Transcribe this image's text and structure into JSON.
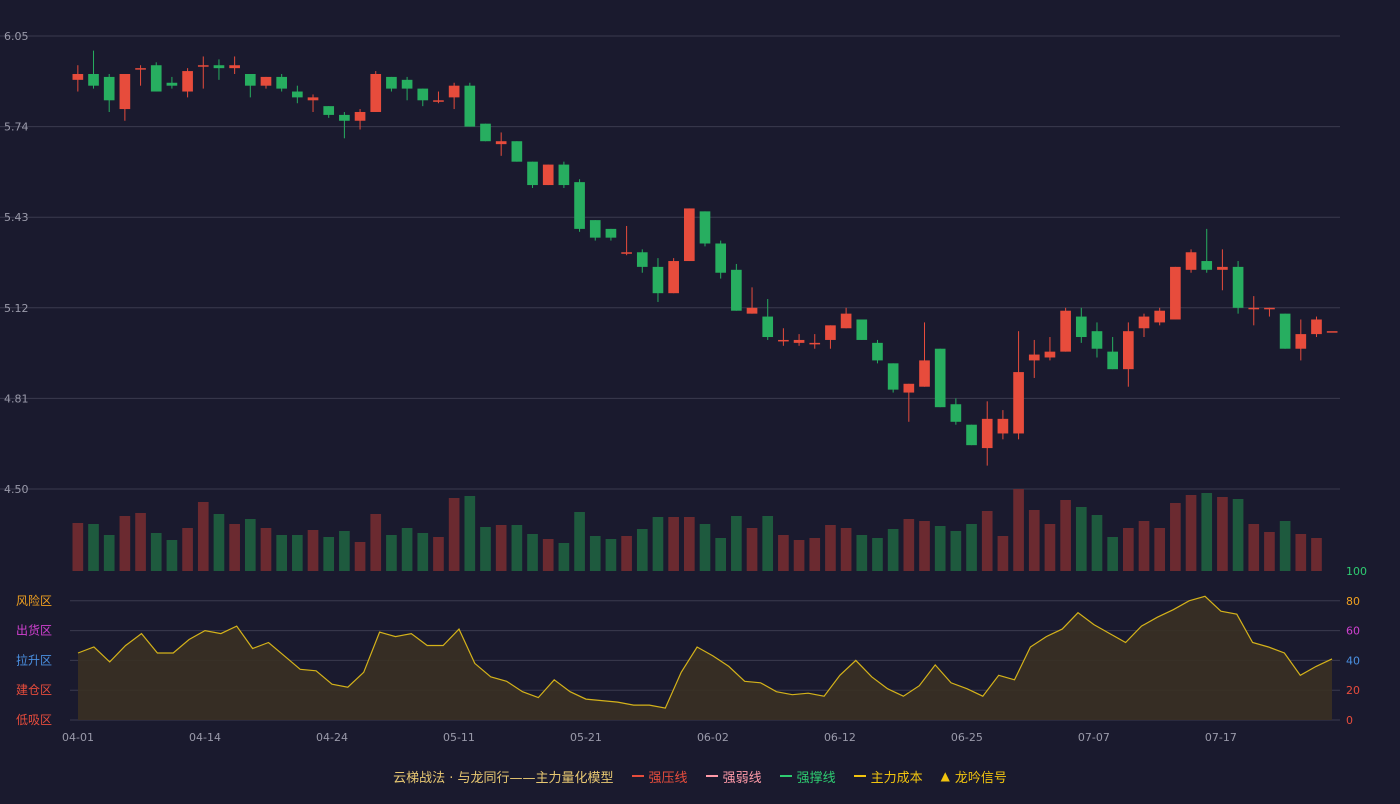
{
  "chart_data": {
    "type": "candlestick",
    "dates": [
      "04-01",
      "04-02",
      "04-03",
      "04-07",
      "04-08",
      "04-09",
      "04-10",
      "04-11",
      "04-14",
      "04-15",
      "04-16",
      "04-17",
      "04-18",
      "04-21",
      "04-22",
      "04-23",
      "04-24",
      "04-25",
      "04-28",
      "04-29",
      "04-30",
      "05-06",
      "05-07",
      "05-08",
      "05-09",
      "05-11",
      "05-12",
      "05-13",
      "05-14",
      "05-15",
      "05-16",
      "05-19",
      "05-20",
      "05-21",
      "05-22",
      "05-23",
      "05-26",
      "05-27",
      "05-28",
      "05-29",
      "05-30",
      "06-02",
      "06-03",
      "06-04",
      "06-05",
      "06-06",
      "06-09",
      "06-10",
      "06-11",
      "06-12",
      "06-13",
      "06-16",
      "06-17",
      "06-18",
      "06-19",
      "06-20",
      "06-23",
      "06-24",
      "06-25",
      "06-26",
      "06-27",
      "06-30",
      "07-01",
      "07-02",
      "07-03",
      "07-04",
      "07-07",
      "07-08",
      "07-09",
      "07-10",
      "07-11",
      "07-14",
      "07-15",
      "07-16",
      "07-17",
      "07-18",
      "07-21",
      "07-22",
      "07-23",
      "07-24",
      "07-25"
    ],
    "ohlc": [
      [
        5.9,
        5.92,
        5.86,
        5.95
      ],
      [
        5.92,
        5.88,
        5.87,
        6.0
      ],
      [
        5.91,
        5.83,
        5.79,
        5.92
      ],
      [
        5.8,
        5.92,
        5.76,
        5.92
      ],
      [
        5.94,
        5.94,
        5.88,
        5.95
      ],
      [
        5.95,
        5.86,
        5.86,
        5.96
      ],
      [
        5.89,
        5.88,
        5.87,
        5.91
      ],
      [
        5.86,
        5.93,
        5.84,
        5.94
      ],
      [
        5.95,
        5.95,
        5.87,
        5.98
      ],
      [
        5.95,
        5.94,
        5.9,
        5.97
      ],
      [
        5.94,
        5.95,
        5.92,
        5.98
      ],
      [
        5.92,
        5.88,
        5.84,
        5.92
      ],
      [
        5.88,
        5.91,
        5.87,
        5.91
      ],
      [
        5.91,
        5.87,
        5.86,
        5.92
      ],
      [
        5.86,
        5.84,
        5.82,
        5.88
      ],
      [
        5.83,
        5.84,
        5.79,
        5.85
      ],
      [
        5.81,
        5.78,
        5.77,
        5.81
      ],
      [
        5.78,
        5.76,
        5.7,
        5.79
      ],
      [
        5.76,
        5.79,
        5.73,
        5.8
      ],
      [
        5.79,
        5.92,
        5.79,
        5.93
      ],
      [
        5.91,
        5.87,
        5.86,
        5.91
      ],
      [
        5.9,
        5.87,
        5.83,
        5.91
      ],
      [
        5.87,
        5.83,
        5.81,
        5.87
      ],
      [
        5.83,
        5.83,
        5.82,
        5.86
      ],
      [
        5.84,
        5.88,
        5.8,
        5.89
      ],
      [
        5.88,
        5.74,
        5.74,
        5.89
      ],
      [
        5.75,
        5.69,
        5.69,
        5.75
      ],
      [
        5.68,
        5.69,
        5.64,
        5.72
      ],
      [
        5.69,
        5.62,
        5.62,
        5.69
      ],
      [
        5.62,
        5.54,
        5.53,
        5.62
      ],
      [
        5.54,
        5.61,
        5.54,
        5.61
      ],
      [
        5.61,
        5.54,
        5.53,
        5.62
      ],
      [
        5.55,
        5.39,
        5.38,
        5.56
      ],
      [
        5.42,
        5.36,
        5.35,
        5.42
      ],
      [
        5.39,
        5.36,
        5.35,
        5.39
      ],
      [
        5.31,
        5.31,
        5.3,
        5.4
      ],
      [
        5.31,
        5.26,
        5.24,
        5.32
      ],
      [
        5.26,
        5.17,
        5.14,
        5.29
      ],
      [
        5.17,
        5.28,
        5.17,
        5.29
      ],
      [
        5.28,
        5.46,
        5.28,
        5.46
      ],
      [
        5.45,
        5.34,
        5.33,
        5.45
      ],
      [
        5.34,
        5.24,
        5.22,
        5.35
      ],
      [
        5.25,
        5.11,
        5.11,
        5.27
      ],
      [
        5.1,
        5.12,
        5.1,
        5.19
      ],
      [
        5.09,
        5.02,
        5.01,
        5.15
      ],
      [
        5.01,
        5.01,
        4.99,
        5.05
      ],
      [
        5.0,
        5.01,
        4.99,
        5.03
      ],
      [
        5.0,
        5.0,
        4.98,
        5.03
      ],
      [
        5.01,
        5.06,
        4.98,
        5.06
      ],
      [
        5.05,
        5.1,
        5.05,
        5.12
      ],
      [
        5.08,
        5.01,
        5.01,
        5.08
      ],
      [
        5.0,
        4.94,
        4.93,
        5.01
      ],
      [
        4.93,
        4.84,
        4.83,
        4.93
      ],
      [
        4.83,
        4.86,
        4.73,
        4.86
      ],
      [
        4.85,
        4.94,
        4.85,
        5.07
      ],
      [
        4.98,
        4.78,
        4.78,
        4.98
      ],
      [
        4.79,
        4.73,
        4.72,
        4.81
      ],
      [
        4.72,
        4.65,
        4.65,
        4.72
      ],
      [
        4.64,
        4.74,
        4.58,
        4.8
      ],
      [
        4.69,
        4.74,
        4.67,
        4.77
      ],
      [
        4.69,
        4.9,
        4.67,
        5.04
      ],
      [
        4.94,
        4.96,
        4.88,
        5.01
      ],
      [
        4.95,
        4.97,
        4.94,
        5.02
      ],
      [
        4.97,
        5.11,
        4.97,
        5.12
      ],
      [
        5.09,
        5.02,
        5.0,
        5.12
      ],
      [
        5.04,
        4.98,
        4.95,
        5.07
      ],
      [
        4.97,
        4.91,
        4.91,
        5.02
      ],
      [
        4.91,
        5.04,
        4.85,
        5.07
      ],
      [
        5.05,
        5.09,
        5.02,
        5.1
      ],
      [
        5.07,
        5.11,
        5.06,
        5.12
      ],
      [
        5.08,
        5.26,
        5.08,
        5.26
      ],
      [
        5.25,
        5.31,
        5.24,
        5.32
      ],
      [
        5.28,
        5.25,
        5.24,
        5.39
      ],
      [
        5.25,
        5.26,
        5.18,
        5.32
      ],
      [
        5.26,
        5.12,
        5.1,
        5.28
      ],
      [
        5.12,
        5.12,
        5.06,
        5.16
      ],
      [
        5.12,
        5.12,
        5.09,
        5.12
      ],
      [
        5.1,
        4.98,
        4.98,
        5.1
      ],
      [
        4.98,
        5.03,
        4.94,
        5.08
      ],
      [
        5.03,
        5.08,
        5.02,
        5.09
      ],
      [
        5.04,
        5.04,
        5.04,
        5.04
      ]
    ],
    "volume_note": "relative volume bars colored by candle direction",
    "volume": [
      48,
      47,
      36,
      55,
      58,
      38,
      31,
      43,
      69,
      57,
      47,
      52,
      43,
      36,
      36,
      41,
      34,
      40,
      29,
      57,
      36,
      43,
      38,
      34,
      73,
      75,
      44,
      46,
      46,
      37,
      32,
      28,
      59,
      35,
      32,
      35,
      42,
      54,
      54,
      54,
      47,
      33,
      55,
      43,
      55,
      36,
      31,
      33,
      46,
      43,
      36,
      33,
      42,
      52,
      50,
      45,
      40,
      47,
      60,
      35,
      82,
      61,
      47,
      71,
      64,
      56,
      34,
      43,
      50,
      43,
      68,
      76,
      78,
      74,
      72,
      47,
      39,
      50,
      37,
      33
    ],
    "oscillator": [
      45,
      49,
      39,
      50,
      58,
      45,
      45,
      54,
      60,
      58,
      63,
      48,
      52,
      43,
      34,
      33,
      24,
      22,
      32,
      59,
      56,
      58,
      50,
      50,
      61,
      38,
      29,
      26,
      19,
      15,
      27,
      19,
      14,
      13,
      12,
      10,
      10,
      8,
      32,
      49,
      43,
      36,
      26,
      25,
      19,
      17,
      18,
      16,
      30,
      40,
      29,
      21,
      16,
      23,
      37,
      25,
      21,
      16,
      30,
      27,
      49,
      56,
      61,
      72,
      64,
      58,
      52,
      63,
      69,
      74,
      80,
      83,
      73,
      71,
      52,
      49,
      45,
      30,
      36,
      41
    ],
    "price_ticks": [
      "6.05",
      "5.74",
      "5.43",
      "5.12",
      "4.81",
      "4.50"
    ],
    "price_range": [
      4.5,
      6.05
    ],
    "osc_ticks": [
      "100",
      "80",
      "60",
      "40",
      "20",
      "0"
    ],
    "osc_range": [
      0,
      100
    ],
    "zones": [
      "风险区",
      "出货区",
      "拉升区",
      "建仓区",
      "低吸区"
    ],
    "x_ticks": [
      {
        "index": 0,
        "label": "04-01"
      },
      {
        "index": 8,
        "label": "04-14"
      },
      {
        "index": 16,
        "label": "04-24"
      },
      {
        "index": 24,
        "label": "05-11"
      },
      {
        "index": 32,
        "label": "05-21"
      },
      {
        "index": 40,
        "label": "06-02"
      },
      {
        "index": 48,
        "label": "06-12"
      },
      {
        "index": 56,
        "label": "06-25"
      },
      {
        "index": 64,
        "label": "07-07"
      },
      {
        "index": 72,
        "label": "07-17"
      }
    ],
    "colors": {
      "background": "#1a1a2e",
      "up": "#e74c3c",
      "down": "#27ae60",
      "grid": "#3a3a4e",
      "axis_text": "#9a9aaa",
      "osc_line": "#d4b21a",
      "osc_fill": "#3a3024",
      "zone_colors": [
        "#f0a020",
        "#d040d0",
        "#4a90e2",
        "#e74c3c",
        "#e74c3c"
      ],
      "osc_tick_colors": [
        "#2ecc71",
        "#f0a020",
        "#d040d0",
        "#4a90e2",
        "#e74c3c",
        "#e74c3c"
      ]
    },
    "grid": true
  },
  "legend": {
    "title": "云梯战法 · 与龙同行——主力量化模型",
    "items": [
      {
        "label": "强压线",
        "color": "#e74c3c",
        "style": "solid"
      },
      {
        "label": "强弱线",
        "color": "#ff9aa8",
        "style": "dashed"
      },
      {
        "label": "强撑线",
        "color": "#2ecc71",
        "style": "solid"
      },
      {
        "label": "主力成本",
        "color": "#f1c40f",
        "style": "dashed"
      },
      {
        "label": "龙吟信号",
        "color": "#f1c40f",
        "style": "triangle"
      }
    ]
  }
}
